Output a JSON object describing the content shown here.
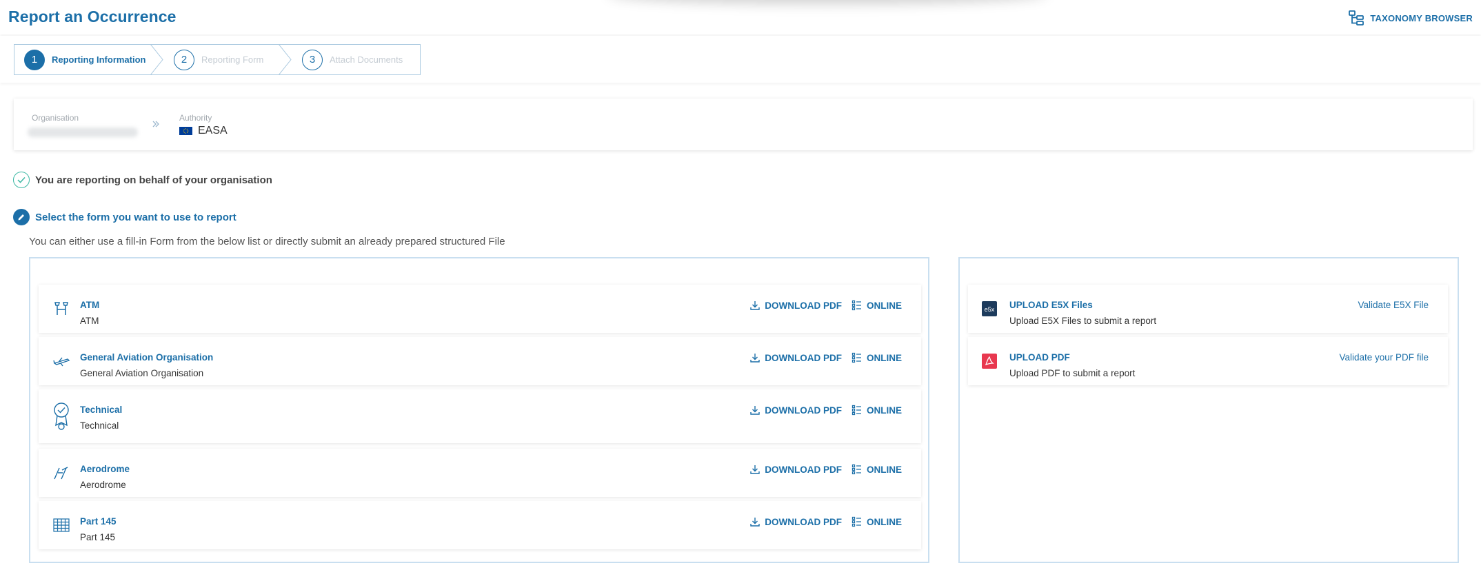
{
  "header": {
    "title": "Report an Occurrence",
    "taxonomy_label": "TAXONOMY BROWSER"
  },
  "steps": [
    {
      "num": "1",
      "label": "Reporting Information",
      "active": true
    },
    {
      "num": "2",
      "label": "Reporting Form",
      "active": false
    },
    {
      "num": "3",
      "label": "Attach Documents",
      "active": false
    }
  ],
  "organisation": {
    "org_label": "Organisation",
    "authority_label": "Authority",
    "authority_value": "EASA"
  },
  "status": {
    "behalf_msg": "You are reporting on behalf of your organisation",
    "select_msg": "Select the form you want to use to report",
    "instruction": "You can either use a fill-in Form from the below list or directly submit an already prepared structured File"
  },
  "forms": [
    {
      "name": "ATM",
      "desc": "ATM",
      "icon": "atm-tower-icon"
    },
    {
      "name": "General Aviation Organisation",
      "desc": "General Aviation Organisation",
      "icon": "small-aircraft-icon"
    },
    {
      "name": "Technical",
      "desc": "Technical",
      "icon": "technical-badge-icon"
    },
    {
      "name": "Aerodrome",
      "desc": "Aerodrome",
      "icon": "aerodrome-runway-icon"
    },
    {
      "name": "Part 145",
      "desc": "Part 145",
      "icon": "part145-grid-icon"
    }
  ],
  "actions": {
    "download": "DOWNLOAD PDF",
    "online": "ONLINE"
  },
  "uploads": [
    {
      "name": "UPLOAD E5X Files",
      "desc": "Upload E5X Files to submit a report",
      "link": "Validate E5X File",
      "icon": "e5x-file-icon",
      "badge": "e5x"
    },
    {
      "name": "UPLOAD PDF",
      "desc": "Upload PDF to submit a report",
      "link": "Validate your PDF file",
      "icon": "pdf-file-icon"
    }
  ],
  "colors": {
    "primary": "#1c6fa8",
    "success": "#3db8a4",
    "pdf": "#e8384f",
    "e5x": "#1d3b5c"
  }
}
